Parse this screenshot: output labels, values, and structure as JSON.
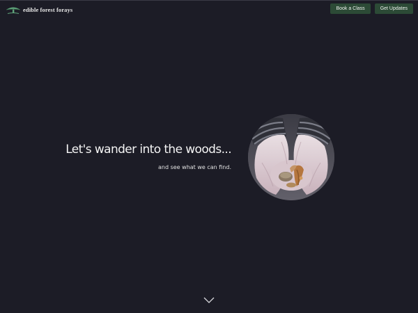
{
  "header": {
    "brand": {
      "name": "edible forest forays",
      "logo_icon": "mushroom-logo-icon",
      "logo_color": "#5fa37a"
    },
    "buttons": [
      {
        "label": "Book a Class"
      },
      {
        "label": "Get Updates"
      }
    ],
    "button_color": "#2c4a36"
  },
  "hero": {
    "title": "Let's wander into the woods...",
    "subtitle": "and see what we can find.",
    "image": "hands-holding-mushrooms-photo",
    "scroll_icon": "chevron-down-icon"
  },
  "colors": {
    "background": "#1c1c26",
    "text": "#f4f4f4"
  }
}
